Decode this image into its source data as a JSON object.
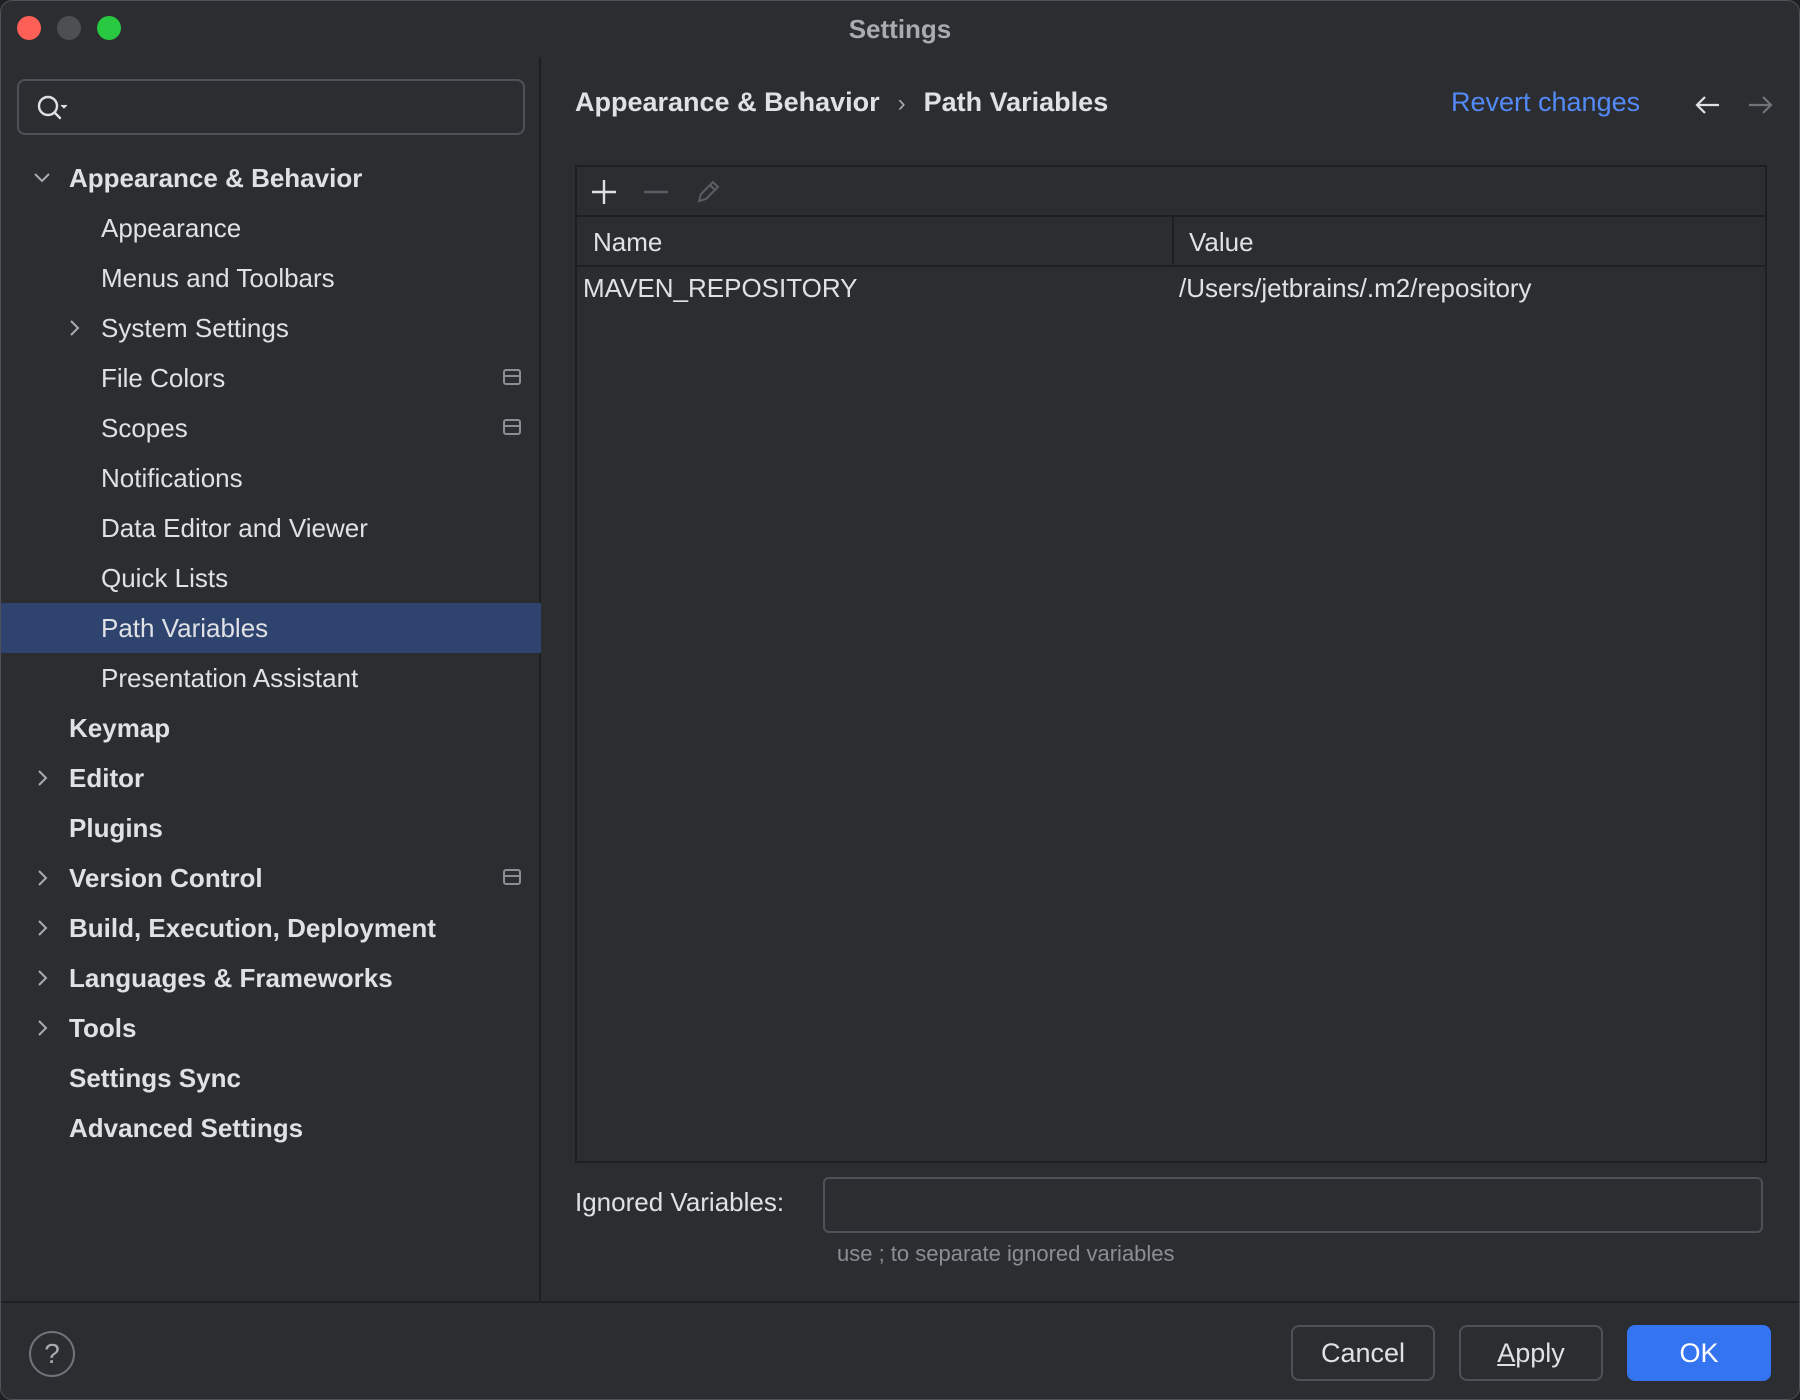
{
  "window": {
    "title": "Settings"
  },
  "sidebar": {
    "search": {
      "placeholder": "",
      "value": ""
    },
    "items": [
      {
        "label": "Appearance & Behavior",
        "level": 0,
        "expanded": true
      },
      {
        "label": "Appearance",
        "level": 1
      },
      {
        "label": "Menus and Toolbars",
        "level": 1
      },
      {
        "label": "System Settings",
        "level": 1,
        "collapsed": true
      },
      {
        "label": "File Colors",
        "level": 1,
        "project_badge": true
      },
      {
        "label": "Scopes",
        "level": 1,
        "project_badge": true
      },
      {
        "label": "Notifications",
        "level": 1
      },
      {
        "label": "Data Editor and Viewer",
        "level": 1
      },
      {
        "label": "Quick Lists",
        "level": 1
      },
      {
        "label": "Path Variables",
        "level": 1,
        "selected": true
      },
      {
        "label": "Presentation Assistant",
        "level": 1
      },
      {
        "label": "Keymap",
        "level": 0
      },
      {
        "label": "Editor",
        "level": 0,
        "collapsed": true
      },
      {
        "label": "Plugins",
        "level": 0
      },
      {
        "label": "Version Control",
        "level": 0,
        "collapsed": true,
        "project_badge": true
      },
      {
        "label": "Build, Execution, Deployment",
        "level": 0,
        "collapsed": true
      },
      {
        "label": "Languages & Frameworks",
        "level": 0,
        "collapsed": true
      },
      {
        "label": "Tools",
        "level": 0,
        "collapsed": true
      },
      {
        "label": "Settings Sync",
        "level": 0
      },
      {
        "label": "Advanced Settings",
        "level": 0
      }
    ]
  },
  "content": {
    "breadcrumb": {
      "parent": "Appearance & Behavior",
      "separator": "›",
      "current": "Path Variables"
    },
    "revert_label": "Revert changes",
    "table": {
      "columns": [
        "Name",
        "Value"
      ],
      "rows": [
        {
          "name": "MAVEN_REPOSITORY",
          "value": "/Users/jetbrains/.m2/repository"
        }
      ]
    },
    "ignored": {
      "label": "Ignored Variables:",
      "value": "",
      "hint": "use ; to separate ignored variables"
    }
  },
  "footer": {
    "help_label": "?",
    "cancel_label": "Cancel",
    "apply_label_first": "A",
    "apply_label_rest": "pply",
    "ok_label": "OK"
  },
  "colors": {
    "background": "#2b2d30",
    "selection": "#2e436e",
    "accent": "#3574f0",
    "link": "#548af7",
    "text": "#dfe1e5"
  }
}
